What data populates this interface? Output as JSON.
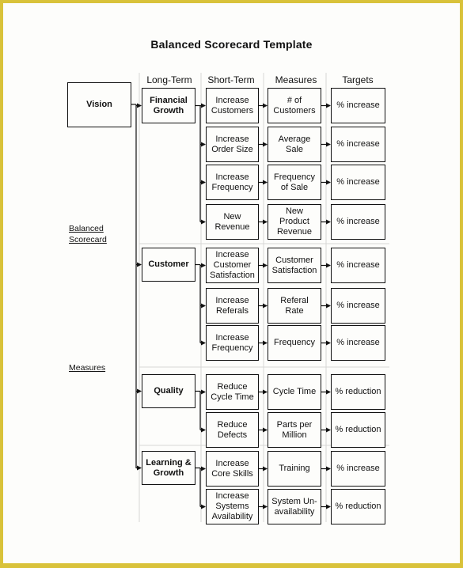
{
  "title": "Balanced Scorecard Template",
  "column_headers": [
    "Long-Term",
    "Short-Term",
    "Measures",
    "Targets"
  ],
  "vision": "Vision",
  "side_labels": {
    "balanced_scorecard": "Balanced\nScorecard",
    "measures": "Measures"
  },
  "perspectives": [
    {
      "name": "Financial\nGrowth",
      "rows": [
        {
          "short_term": "Increase\nCustomers",
          "measure": "# of\nCustomers",
          "target": "% increase"
        },
        {
          "short_term": "Increase\nOrder Size",
          "measure": "Average\nSale",
          "target": "% increase"
        },
        {
          "short_term": "Increase\nFrequency",
          "measure": "Frequency\nof Sale",
          "target": "% increase"
        },
        {
          "short_term": "New\nRevenue",
          "measure": "New\nProduct\nRevenue",
          "target": "% increase"
        }
      ]
    },
    {
      "name": "Customer",
      "rows": [
        {
          "short_term": "Increase\nCustomer\nSatisfaction",
          "measure": "Customer\nSatisfaction",
          "target": "% increase"
        },
        {
          "short_term": "Increase\nReferals",
          "measure": "Referal\nRate",
          "target": "% increase"
        },
        {
          "short_term": "Increase\nFrequency",
          "measure": "Frequency",
          "target": "% increase"
        }
      ]
    },
    {
      "name": "Quality",
      "rows": [
        {
          "short_term": "Reduce\nCycle Time",
          "measure": "Cycle Time",
          "target": "% reduction"
        },
        {
          "short_term": "Reduce\nDefects",
          "measure": "Parts per\nMillion",
          "target": "% reduction"
        }
      ]
    },
    {
      "name": "Learning &\nGrowth",
      "rows": [
        {
          "short_term": "Increase\nCore Skills",
          "measure": "Training",
          "target": "% increase"
        },
        {
          "short_term": "Increase\nSystems\nAvailability",
          "measure": "System Un-\navailability",
          "target": "% reduction"
        }
      ]
    }
  ]
}
